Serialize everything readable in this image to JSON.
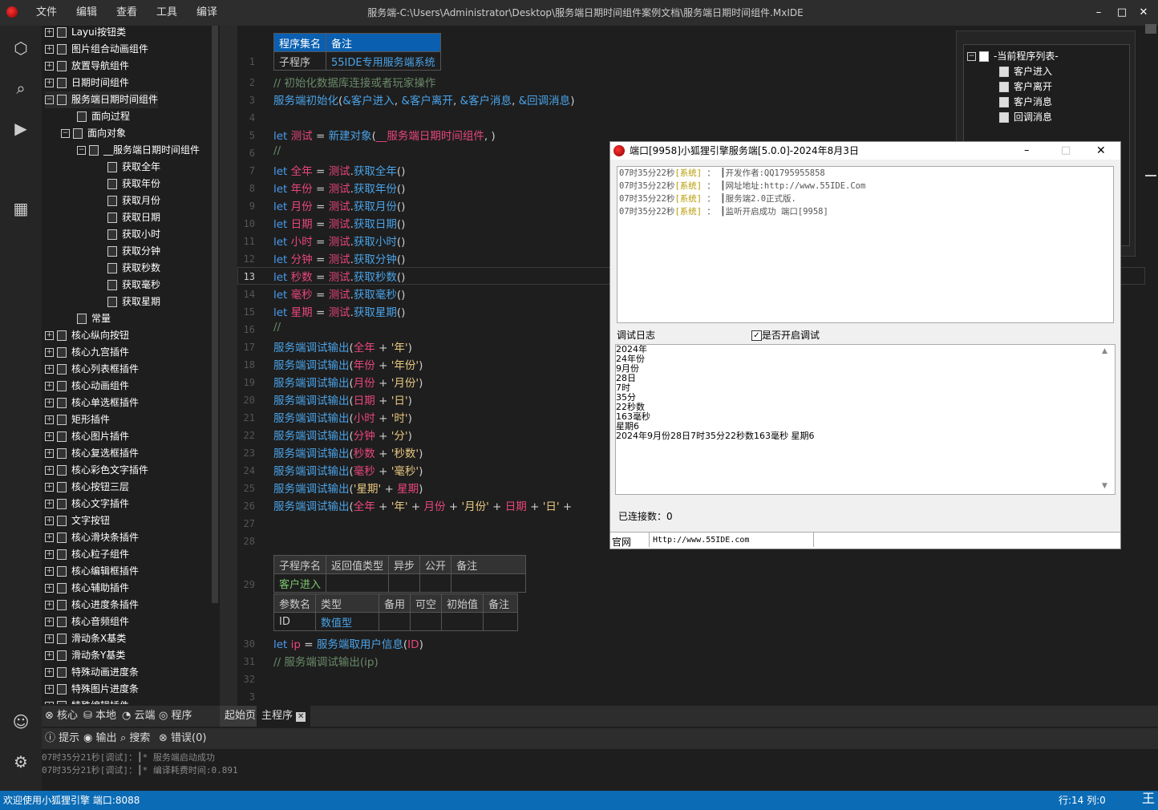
{
  "app": {
    "menu": [
      "文件",
      "编辑",
      "查看",
      "工具",
      "编译"
    ],
    "title": "服务端-C:\\Users\\Administrator\\Desktop\\服务端日期时间组件案例文档\\服务端日期时间组件.MxIDE",
    "win_min": "–",
    "win_max": "□",
    "win_close": "✕"
  },
  "tree": {
    "top": [
      "Layui按钮类",
      "图片组合动画组件",
      "放置导航组件",
      "日期时间组件"
    ],
    "open": "服务端日期时间组件",
    "proc": "面向过程",
    "obj": "面向对象",
    "cls": "__服务端日期时间组件",
    "methods": [
      "获取全年",
      "获取年份",
      "获取月份",
      "获取日期",
      "获取小时",
      "获取分钟",
      "获取秒数",
      "获取毫秒",
      "获取星期"
    ],
    "const": "常量",
    "rest": [
      "核心纵向按钮",
      "核心九宫插件",
      "核心列表框插件",
      "核心动画组件",
      "核心单选框插件",
      "矩形插件",
      "核心图片插件",
      "核心复选框插件",
      "核心彩色文字插件",
      "核心按钮三层",
      "核心文字插件",
      "文字按钮",
      "核心滑块条插件",
      "核心粒子组件",
      "核心编辑框插件",
      "核心辅助插件",
      "核心进度条插件",
      "核心音频组件",
      "滑动条X基类",
      "滑动条Y基类",
      "特殊动画进度条",
      "特殊图片进度条",
      "特殊编辑插件"
    ]
  },
  "editor": {
    "header_table": {
      "col1": "程序集名",
      "col2": "备注",
      "v1": "子程序",
      "v2": "55IDE专用服务端系统"
    },
    "line_numbers": [
      "1",
      "2",
      "3",
      "4",
      "5",
      "6",
      "7",
      "8",
      "9",
      "10",
      "11",
      "12",
      "13",
      "14",
      "15",
      "16",
      "17",
      "18",
      "19",
      "20",
      "21",
      "22",
      "23",
      "24",
      "25",
      "26",
      "27",
      "28",
      "29",
      "30",
      "31",
      "32",
      "3"
    ],
    "sub_table": {
      "h": [
        "子程序名",
        "返回值类型",
        "异步",
        "公开",
        "备注"
      ],
      "name": "客户进入",
      "ph": [
        "参数名",
        "类型",
        "备用",
        "可空",
        "初始值",
        "备注"
      ],
      "p": [
        "ID",
        "数值型"
      ]
    }
  },
  "program_list": {
    "root": "-当前程序列表-",
    "items": [
      "客户进入",
      "客户离开",
      "客户消息",
      "回调消息"
    ]
  },
  "dialog": {
    "title": "端口[9958]小狐狸引擎服务端[5.0.0]-2024年8月3日",
    "log": [
      [
        "07时35分22秒",
        "[系统]",
        "：",
        "┃开发作者:QQ1795955858"
      ],
      [
        "07时35分22秒",
        "[系统]",
        "：",
        "┃网址地址:http://www.55IDE.Com"
      ],
      [
        "07时35分22秒",
        "[系统]",
        "：",
        "┃服务端2.0正式版."
      ],
      [
        "07时35分22秒",
        "[系统]",
        "：",
        "┃监听开启成功 端口[9958]"
      ]
    ],
    "debug_label": "调试日志",
    "debug_checkbox": "是否开启调试",
    "debug_lines": [
      "2024年",
      "24年份",
      "9月份",
      "28日",
      "7时",
      "35分",
      "22秒数",
      "163毫秒",
      "星期6",
      "2024年9月份28日7时35分22秒数163毫秒 星期6"
    ],
    "connections": "已连接数：0",
    "site_label": "官网",
    "site_url": "Http://www.55IDE.com"
  },
  "bottom": {
    "tabs1": [
      "核心",
      "本地",
      "云端",
      "程序"
    ],
    "file_tabs": [
      "起始页",
      "主程序"
    ],
    "tabs2": [
      "提示",
      "输出",
      "搜索",
      "错误(0)"
    ],
    "output": [
      "07时35分21秒[调试]：┃* 服务端启动成功",
      "07时35分21秒[调试]：┃* 编译耗费时间:0.891"
    ]
  },
  "status": {
    "left": "欢迎使用小狐狸引擎 端口:8088",
    "right": "行:14 列:0",
    "ime": "王"
  }
}
